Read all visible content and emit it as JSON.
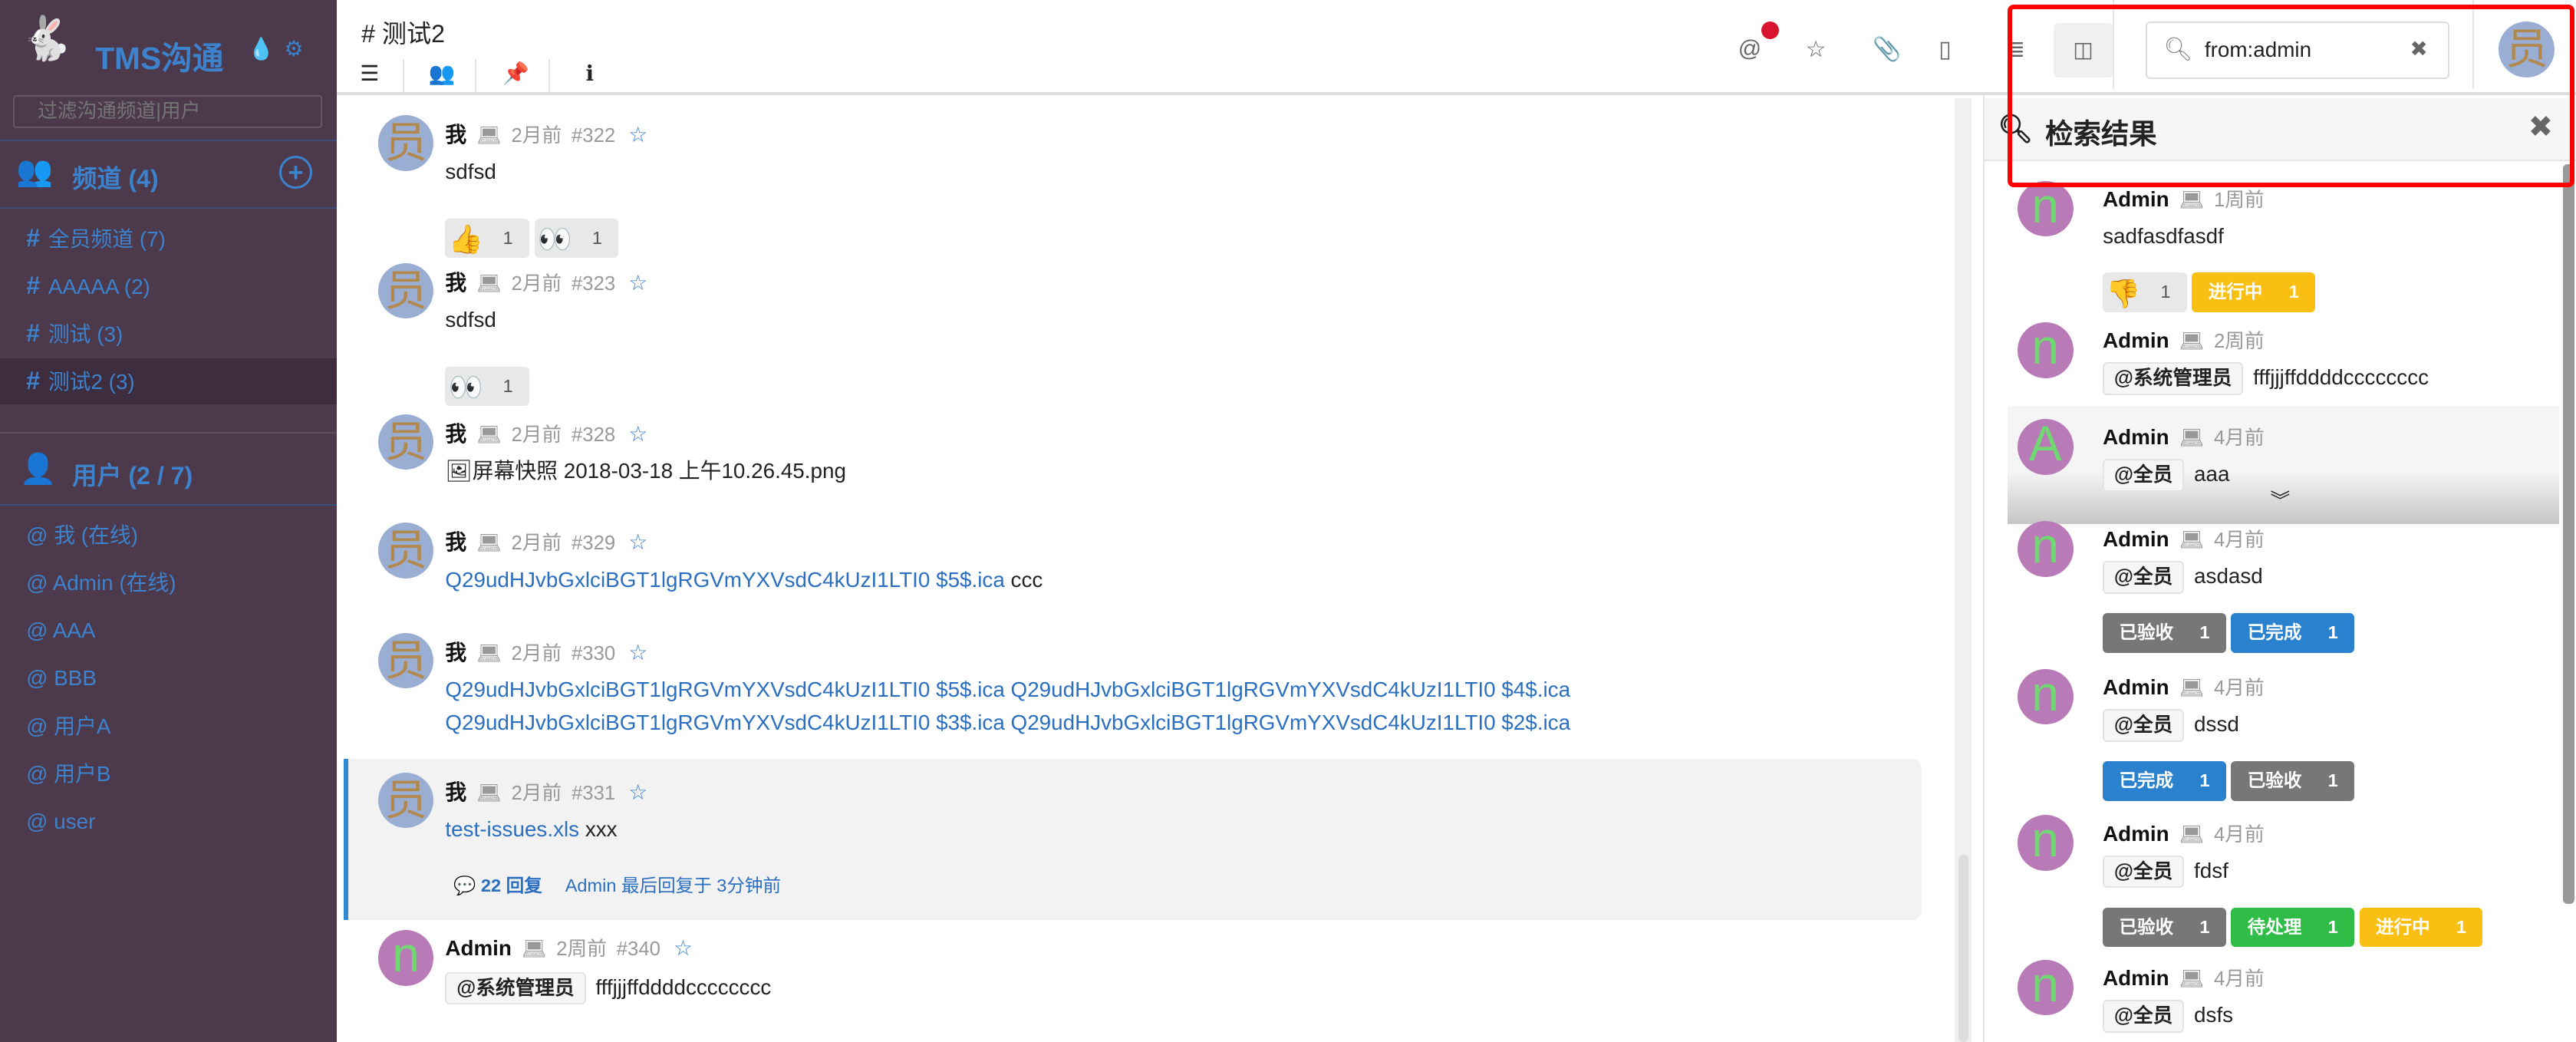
{
  "sidebar": {
    "brand": "TMS沟通",
    "filter_placeholder": "过滤沟通频道|用户",
    "channels_header": "频道 (4)",
    "channels": [
      {
        "label": "全员频道 (7)",
        "active": false
      },
      {
        "label": "AAAAA (2)",
        "active": false
      },
      {
        "label": "测试 (3)",
        "active": false
      },
      {
        "label": "测试2 (3)",
        "active": true
      }
    ],
    "users_header": "用户 (2 / 7)",
    "users": [
      "我 (在线)",
      "Admin (在线)",
      "AAA",
      "BBB",
      "用户A",
      "用户B",
      "user"
    ]
  },
  "header": {
    "title": "# 测试2",
    "search_value": "from:admin"
  },
  "messages": [
    {
      "author": "我",
      "avatar": "员",
      "time": "2月前",
      "id": "#322",
      "body": [
        {
          "text": "sdfsd"
        }
      ],
      "reactions": [
        {
          "emoji": "👍",
          "count": "1"
        },
        {
          "emoji": "👀",
          "count": "1"
        }
      ]
    },
    {
      "author": "我",
      "avatar": "员",
      "time": "2月前",
      "id": "#323",
      "body": [
        {
          "text": "sdfsd"
        }
      ],
      "reactions": [
        {
          "emoji": "👀",
          "count": "1"
        }
      ]
    },
    {
      "author": "我",
      "avatar": "员",
      "time": "2月前",
      "id": "#328",
      "body": [
        {
          "text": "🖼屏幕快照 2018-03-18 上午10.26.45.png"
        }
      ]
    },
    {
      "author": "我",
      "avatar": "员",
      "time": "2月前",
      "id": "#329",
      "body": [
        {
          "link": "Q29udHJvbGxlciBGT1lgRGVmYXVsdC4kUzI1LTI0 $5$.ica"
        },
        {
          "text": " ccc"
        }
      ]
    },
    {
      "author": "我",
      "avatar": "员",
      "time": "2月前",
      "id": "#330",
      "body": [
        {
          "link": "Q29udHJvbGxlciBGT1lgRGVmYXVsdC4kUzI1LTI0 $5$.ica Q29udHJvbGxlciBGT1lgRGVmYXVsdC4kUzI1LTI0 $4$.ica Q29udHJvbGxlciBGT1lgRGVmYXVsdC4kUzI1LTI0 $3$.ica Q29udHJvbGxlciBGT1lgRGVmYXVsdC4kUzI1LTI0 $2$.ica"
        }
      ]
    },
    {
      "author": "我",
      "avatar": "员",
      "time": "2月前",
      "id": "#331",
      "body": [
        {
          "link": "test-issues.xls"
        },
        {
          "text": " xxx"
        }
      ],
      "thread": {
        "count": "22 回复",
        "last": "Admin 最后回复于 3分钟前"
      }
    },
    {
      "author": "Admin",
      "avatar": "n",
      "time": "2周前",
      "id": "#340",
      "body": [
        {
          "mention": "@系统管理员"
        },
        {
          "text": "fffjjjffddddcccccccc"
        }
      ]
    }
  ],
  "search_panel": {
    "title": "检索结果",
    "results": [
      {
        "author": "Admin",
        "avatar": "n",
        "time": "1周前",
        "body": [
          {
            "text": "sadfasdfasdf"
          }
        ],
        "reactions": [
          {
            "emoji": "👎",
            "count": "1"
          }
        ],
        "tags": [
          {
            "label": "进行中",
            "count": "1",
            "color": "#f9bf13"
          }
        ]
      },
      {
        "author": "Admin",
        "avatar": "n",
        "time": "2周前",
        "body": [
          {
            "mention": "@系统管理员"
          },
          {
            "text": "fffjjjffddddcccccccc"
          }
        ]
      },
      {
        "author": "Admin",
        "avatar": "A",
        "time": "4月前",
        "body": [
          {
            "mention": "@全员"
          },
          {
            "text": "aaa"
          }
        ],
        "collapsed": true
      },
      {
        "author": "Admin",
        "avatar": "n",
        "time": "4月前",
        "body": [
          {
            "mention": "@全员"
          },
          {
            "text": "asdasd"
          }
        ],
        "tags": [
          {
            "label": "已验收",
            "count": "1",
            "color": "#777777"
          },
          {
            "label": "已完成",
            "count": "1",
            "color": "#2a82cf"
          }
        ]
      },
      {
        "author": "Admin",
        "avatar": "n",
        "time": "4月前",
        "body": [
          {
            "mention": "@全员"
          },
          {
            "text": "dssd"
          }
        ],
        "tags": [
          {
            "label": "已完成",
            "count": "1",
            "color": "#2a82cf"
          },
          {
            "label": "已验收",
            "count": "1",
            "color": "#777777"
          }
        ]
      },
      {
        "author": "Admin",
        "avatar": "n",
        "time": "4月前",
        "body": [
          {
            "mention": "@全员"
          },
          {
            "text": "fdsf"
          }
        ],
        "tags": [
          {
            "label": "已验收",
            "count": "1",
            "color": "#777777"
          },
          {
            "label": "待处理",
            "count": "1",
            "color": "#2fbd48"
          },
          {
            "label": "进行中",
            "count": "1",
            "color": "#f9bf13"
          }
        ]
      },
      {
        "author": "Admin",
        "avatar": "n",
        "time": "4月前",
        "body": [
          {
            "mention": "@全员"
          },
          {
            "text": "dsfs"
          }
        ]
      }
    ]
  },
  "colors": {
    "sidebar_bg": "#4c394c",
    "accent": "#3d82cc",
    "highlight_box": "#ff0000",
    "notification_dot": "#d9142e"
  }
}
